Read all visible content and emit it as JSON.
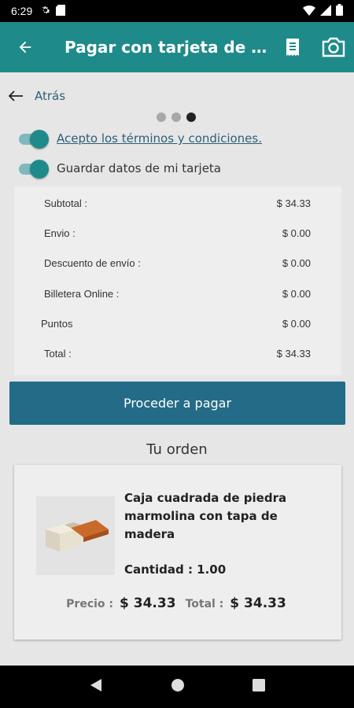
{
  "status_bar": {
    "time": "6:29"
  },
  "app_bar": {
    "title": "Pagar con tarjeta de C..."
  },
  "back": {
    "label": "Atrás"
  },
  "stepper": {
    "steps": 3,
    "active_step": 3
  },
  "toggles": {
    "terms": {
      "label": "Acepto los términos y condiciones.",
      "on": true
    },
    "save_card": {
      "label": "Guardar datos de mi tarjeta",
      "on": true
    }
  },
  "summary": {
    "rows": [
      {
        "label": "Subtotal :",
        "value": "$ 34.33"
      },
      {
        "label": "Envio :",
        "value": "$ 0.00"
      },
      {
        "label": "Descuento de envío :",
        "value": "$ 0.00"
      },
      {
        "label": "Billetera Online :",
        "value": "$ 0.00"
      },
      {
        "label": "Puntos",
        "value": "$ 0.00"
      },
      {
        "label": "Total :",
        "value": "$ 34.33"
      }
    ]
  },
  "pay_button": {
    "label": "Proceder a pagar"
  },
  "order": {
    "heading": "Tu orden",
    "product_name": "Caja cuadrada de piedra marmolina con tapa de madera",
    "quantity": "Cantidad : 1.00",
    "price_label": "Precio :",
    "price_value": "$ 34.33",
    "total_label": "Total :",
    "total_value": "$ 34.33"
  },
  "colors": {
    "primary": "#1f8a8a",
    "button": "#236b86",
    "link": "#2c5f79"
  }
}
